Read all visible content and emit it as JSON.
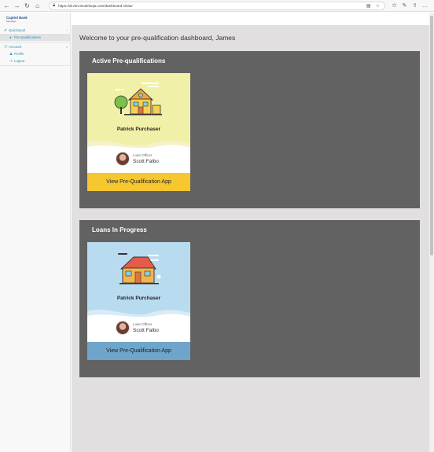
{
  "browser": {
    "url": "https://dt.dev.lendeloqia.com/dashboard-visitor",
    "back_icon": "back-arrow-icon",
    "forward_icon": "forward-arrow-icon"
  },
  "sidebar": {
    "logo_line1": "Capitol Bank",
    "logo_line2": "Mortgage",
    "groups": [
      {
        "label": "QuickQual",
        "icon": "check-icon",
        "items": [
          {
            "label": "Pre-Qualifications",
            "active": true
          }
        ]
      },
      {
        "label": "Account",
        "icon": "users-icon",
        "items": [
          {
            "label": "Profile"
          },
          {
            "label": "Logout"
          }
        ]
      }
    ]
  },
  "main": {
    "welcome": "Welcome to your pre-qualification dashboard, James",
    "sections": [
      {
        "title": "Active Pre-qualifications",
        "card": {
          "borrower": "Patrick Purchaser",
          "officer_label": "Loan Officer",
          "officer_name": "Scott Falbo",
          "button": "View Pre-Qualification App",
          "bg_color": "#f0f0a8",
          "button_color": "#f6c72f"
        }
      },
      {
        "title": "Loans In Progress",
        "card": {
          "borrower": "Patrick Purchaser",
          "officer_label": "Loan Officer",
          "officer_name": "Scott Falbo",
          "button": "View Pre-Qualification App",
          "bg_color": "#b9dbf0",
          "button_color": "#6fa4cb"
        }
      }
    ]
  }
}
